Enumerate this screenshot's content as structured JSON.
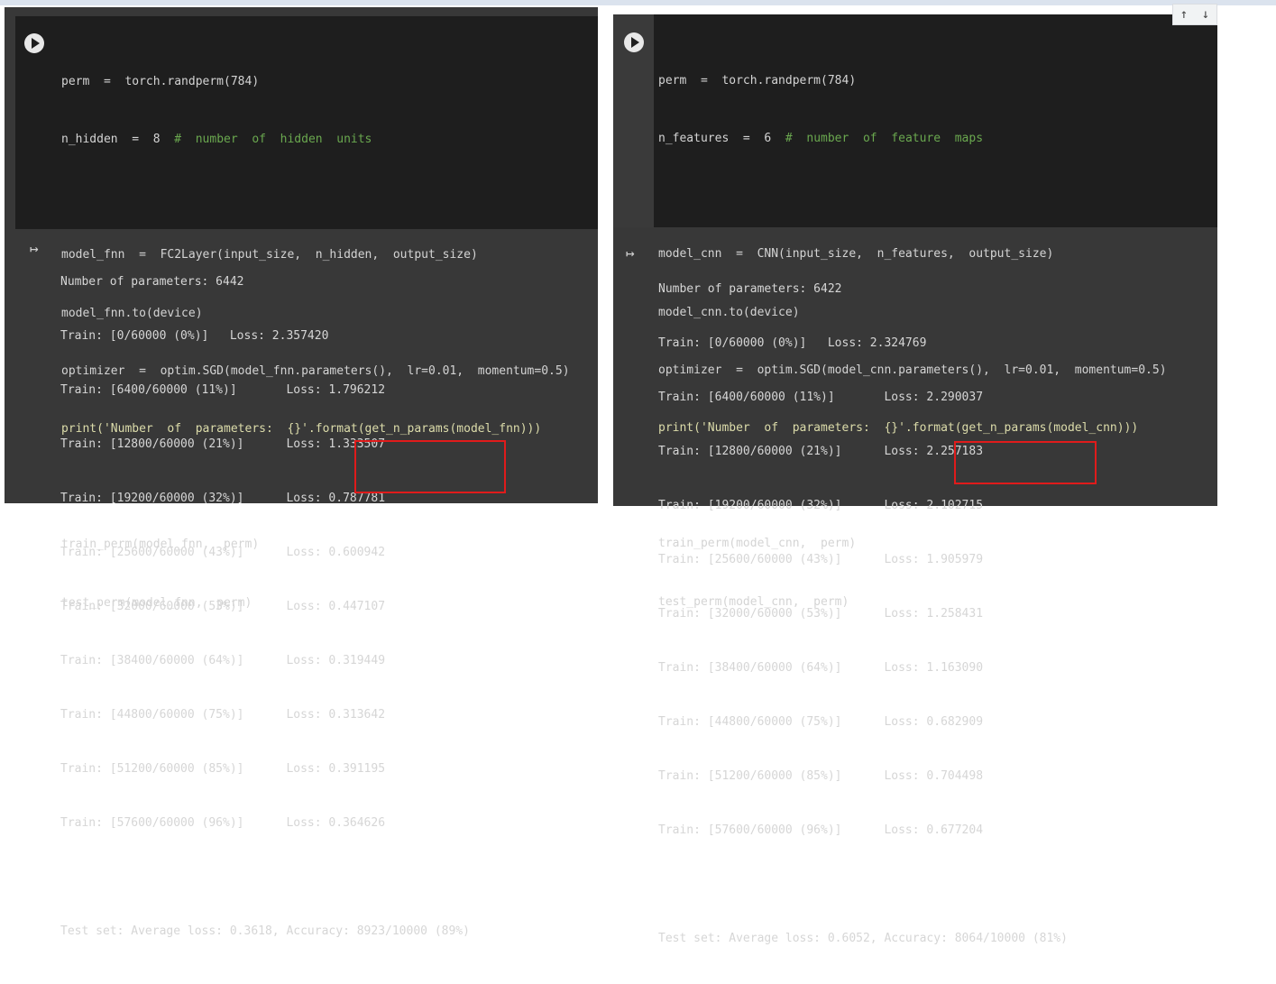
{
  "left": {
    "code_lines": [
      "perm  =  torch.randperm(784)",
      "n_hidden  =  8  ",
      "",
      "model_fnn  =  FC2Layer(input_size,  n_hidden,  output_size)",
      "model_fnn.to(device)",
      "optimizer  =  optim.SGD(model_fnn.parameters(),  lr=0.01,  momentum=0.5)",
      "print('Number  of  parameters:  {}'.format(get_n_params(model_fnn)))",
      "",
      "train_perm(model_fnn,  perm)",
      "test_perm(model_fnn,  perm)"
    ],
    "comment": "#  number  of  hidden  units",
    "output_lines": [
      "Number of parameters: 6442",
      "Train: [0/60000 (0%)]   Loss: 2.357420",
      "Train: [6400/60000 (11%)]       Loss: 1.796212",
      "Train: [12800/60000 (21%)]      Loss: 1.333507",
      "Train: [19200/60000 (32%)]      Loss: 0.787781",
      "Train: [25600/60000 (43%)]      Loss: 0.600942",
      "Train: [32000/60000 (53%)]      Loss: 0.447107",
      "Train: [38400/60000 (64%)]      Loss: 0.319449",
      "Train: [44800/60000 (75%)]      Loss: 0.313642",
      "Train: [51200/60000 (85%)]      Loss: 0.391195",
      "Train: [57600/60000 (96%)]      Loss: 0.364626",
      "",
      "Test set: Average loss: 0.3618, Accuracy: 8923/10000 (89%)"
    ]
  },
  "right": {
    "code_lines": [
      "perm  =  torch.randperm(784)",
      "n_features  =  6  ",
      "",
      "model_cnn  =  CNN(input_size,  n_features,  output_size)",
      "model_cnn.to(device)",
      "optimizer  =  optim.SGD(model_cnn.parameters(),  lr=0.01,  momentum=0.5)",
      "print('Number  of  parameters:  {}'.format(get_n_params(model_cnn)))",
      "",
      "train_perm(model_cnn,  perm)",
      "test_perm(model_cnn,  perm)"
    ],
    "comment": "#  number  of  feature  maps",
    "output_lines": [
      "Number of parameters: 6422",
      "Train: [0/60000 (0%)]   Loss: 2.324769",
      "Train: [6400/60000 (11%)]       Loss: 2.290037",
      "Train: [12800/60000 (21%)]      Loss: 2.257183",
      "Train: [19200/60000 (32%)]      Loss: 2.102715",
      "Train: [25600/60000 (43%)]      Loss: 1.905979",
      "Train: [32000/60000 (53%)]      Loss: 1.258431",
      "Train: [38400/60000 (64%)]      Loss: 1.163090",
      "Train: [44800/60000 (75%)]      Loss: 0.682909",
      "Train: [51200/60000 (85%)]      Loss: 0.704498",
      "Train: [57600/60000 (96%)]      Loss: 0.677204",
      "",
      "Test set: Average loss: 0.6052, Accuracy: 8064/10000 (81%)"
    ]
  },
  "toolbar": {
    "up_icon": "↑",
    "down_icon": "↓"
  },
  "colors": {
    "highlight_box": "#e01b1b",
    "comment": "#6aa84f"
  }
}
